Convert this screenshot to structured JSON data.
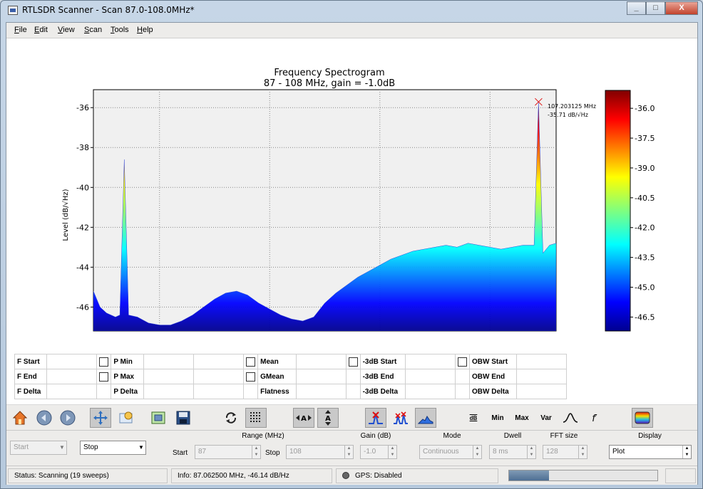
{
  "window": {
    "title": "RTLSDR Scanner - Scan 87.0-108.0MHz*",
    "buttons": [
      "_",
      "□",
      "X"
    ]
  },
  "menu": [
    "File",
    "Edit",
    "View",
    "Scan",
    "Tools",
    "Help"
  ],
  "chart": {
    "title": "Frequency Spectrogram",
    "subtitle": "87 - 108 MHz, gain = -1.0dB",
    "ylabel": "Level (dB/√Hz)",
    "yticks": [
      "-36",
      "-38",
      "-40",
      "-42",
      "-44",
      "-46"
    ],
    "colorbar_ticks": [
      "-36.0",
      "-37.5",
      "-39.0",
      "-40.5",
      "-42.0",
      "-43.5",
      "-45.0",
      "-46.5"
    ],
    "peak_label_freq": "107.203125 MHz",
    "peak_label_level": "-35.71 dB/√Hz"
  },
  "chart_data": {
    "type": "line",
    "title": "Frequency Spectrogram",
    "subtitle": "87 - 108 MHz, gain = -1.0dB",
    "ylabel": "Level (dB/√Hz)",
    "ylim": [
      -47.2,
      -35.1
    ],
    "xlim": [
      87.0,
      108.0
    ],
    "x": [
      87.0,
      87.3,
      87.6,
      88.0,
      88.2,
      88.4,
      88.6,
      89.0,
      89.5,
      90.0,
      90.5,
      91.0,
      91.5,
      92.0,
      92.5,
      93.0,
      93.5,
      94.0,
      94.5,
      95.0,
      95.5,
      96.0,
      96.5,
      97.0,
      97.5,
      98.0,
      98.5,
      99.0,
      99.5,
      100.0,
      100.5,
      101.0,
      101.5,
      102.0,
      102.5,
      103.0,
      103.5,
      104.0,
      104.5,
      105.0,
      105.5,
      106.0,
      106.5,
      107.0,
      107.2,
      107.4,
      107.7,
      108.0
    ],
    "y": [
      -45.2,
      -46.0,
      -46.3,
      -46.5,
      -46.4,
      -38.6,
      -46.4,
      -46.5,
      -46.8,
      -46.9,
      -46.9,
      -46.7,
      -46.4,
      -46.0,
      -45.6,
      -45.3,
      -45.2,
      -45.4,
      -45.8,
      -46.1,
      -46.4,
      -46.6,
      -46.7,
      -46.5,
      -45.8,
      -45.3,
      -44.9,
      -44.5,
      -44.2,
      -43.9,
      -43.6,
      -43.4,
      -43.2,
      -43.1,
      -43.0,
      -42.9,
      -43.0,
      -42.8,
      -42.9,
      -43.0,
      -43.1,
      -43.0,
      -42.9,
      -42.9,
      -35.71,
      -43.3,
      -42.9,
      -42.8
    ],
    "colorbar": {
      "min": -47.2,
      "max": -35.1,
      "colormap": "jet"
    },
    "peak": {
      "freq": 107.203125,
      "level": -35.71
    },
    "grid": true
  },
  "measurements": {
    "col1": [
      "F Start",
      "F End",
      "F Delta"
    ],
    "col2": [
      "P Min",
      "P Max",
      "P Delta"
    ],
    "col3": [
      "Mean",
      "GMean",
      "Flatness"
    ],
    "col4": [
      "-3dB Start",
      "-3dB End",
      "-3dB Delta"
    ],
    "col5": [
      "OBW Start",
      "OBW End",
      "OBW Delta"
    ]
  },
  "toolbar": {
    "text_buttons": [
      "dB",
      "Min",
      "Max",
      "Var"
    ]
  },
  "controls": {
    "start_button": "Start",
    "stop_button": "Stop",
    "range_label": "Range (MHz)",
    "start_label": "Start",
    "start_value": "87",
    "stop_label": "Stop",
    "stop_value": "108",
    "gain_label": "Gain (dB)",
    "gain_value": "-1.0",
    "mode_label": "Mode",
    "mode_value": "Continuous",
    "dwell_label": "Dwell",
    "dwell_value": "8 ms",
    "fft_label": "FFT size",
    "fft_value": "128",
    "display_label": "Display",
    "display_value": "Plot"
  },
  "status": {
    "status": "Status: Scanning (19 sweeps)",
    "info": "Info:  87.062500 MHz, -46.14 dB/Hz",
    "gps": "GPS: Disabled",
    "progress": 0.27
  }
}
